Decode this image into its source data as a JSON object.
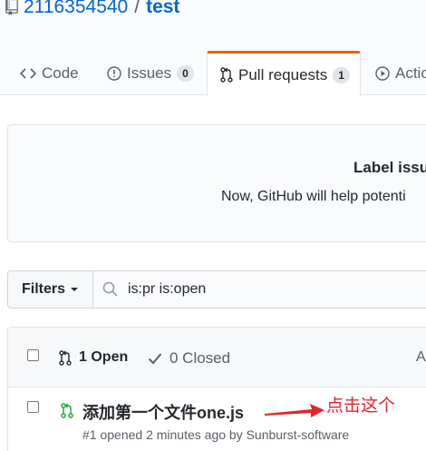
{
  "repo": {
    "owner": "2116354540",
    "separator": "/",
    "name": "test"
  },
  "tabs": [
    {
      "label": "Code",
      "icon": "code-icon"
    },
    {
      "label": "Issues",
      "count": "0",
      "icon": "issue-opened-icon"
    },
    {
      "label": "Pull requests",
      "count": "1",
      "icon": "git-pull-request-icon",
      "selected": true
    },
    {
      "label": "Actio",
      "icon": "play-icon"
    }
  ],
  "blankslate": {
    "title": "Label issu",
    "text": "Now, GitHub will help potenti"
  },
  "filters": {
    "button_label": "Filters",
    "search_value": "is:pr is:open"
  },
  "list": {
    "open_label": "1 Open",
    "closed_label": "0 Closed",
    "author_trunc": "A",
    "items": [
      {
        "title": "添加第一个文件one.js",
        "meta": "#1 opened 2 minutes ago by Sunburst-software"
      }
    ]
  },
  "annotation": {
    "text": "点击这个",
    "color": "#e0262a"
  },
  "colors": {
    "link": "#0366d6",
    "tab_accent": "#e36209",
    "open_green": "#28a745"
  }
}
